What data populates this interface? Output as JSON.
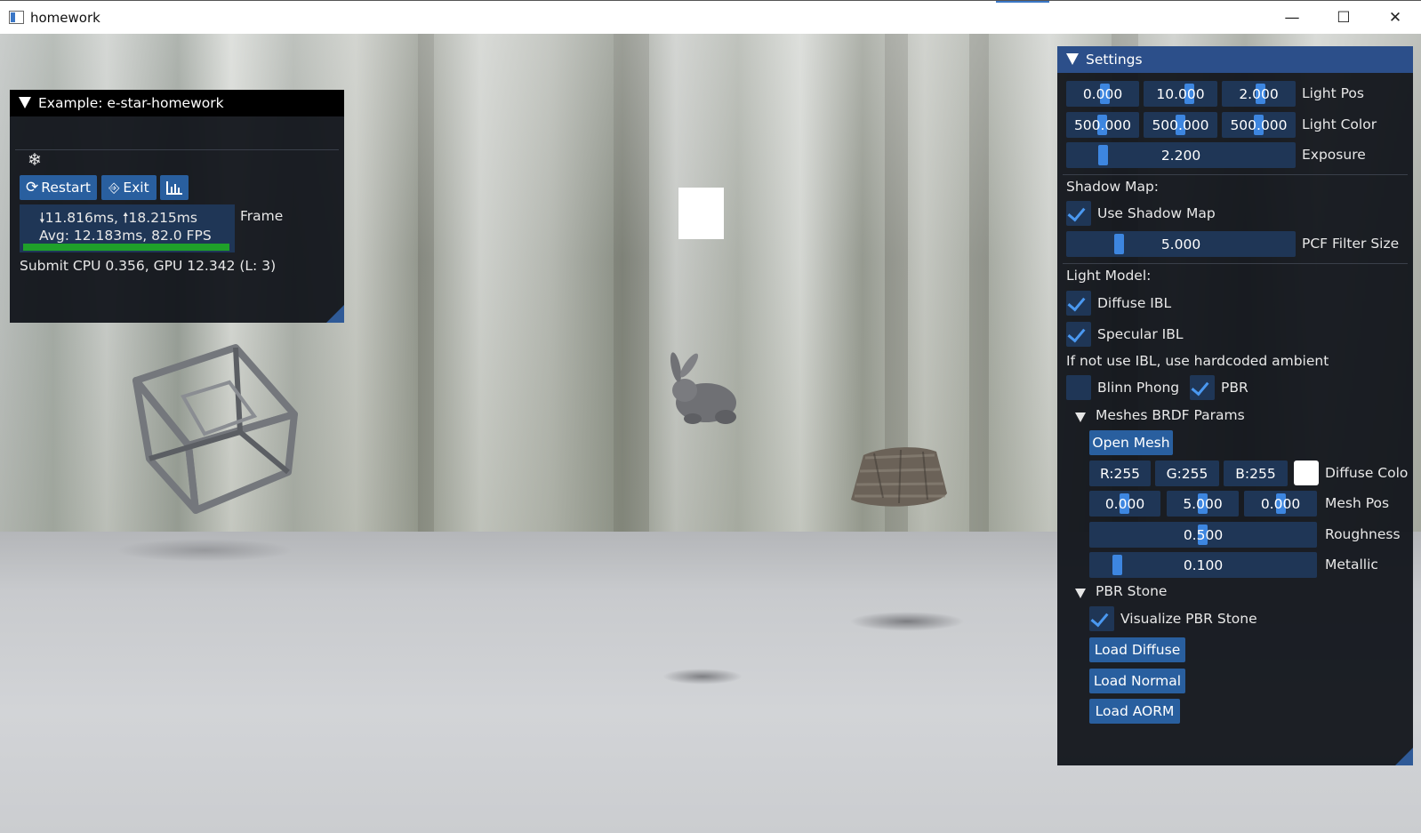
{
  "window": {
    "title": "homework",
    "controls": {
      "minimize": "—",
      "maximize": "☐",
      "close": "✕"
    }
  },
  "example_panel": {
    "title": "Example: e-star-homework",
    "icon": "snowflake-icon",
    "icon_glyph": "❄",
    "buttons": {
      "restart": {
        "icon": "refresh-icon",
        "glyph": "⟳",
        "label": "Restart"
      },
      "exit": {
        "icon": "exit-door-icon",
        "glyph": "⎆",
        "label": "Exit"
      },
      "stats": {
        "icon": "bar-chart-icon",
        "glyph": "📊"
      }
    },
    "frame": {
      "times": "🠗11.816ms, 🠕18.215ms",
      "avg": "Avg: 12.183ms, 82.0 FPS",
      "label": "Frame"
    },
    "submit": "Submit CPU 0.356, GPU 12.342 (L: 3)"
  },
  "settings": {
    "title": "Settings",
    "light_pos": {
      "values": [
        "0.000",
        "10.000",
        "2.000"
      ],
      "label": "Light Pos"
    },
    "light_color": {
      "values": [
        "500.000",
        "500.000",
        "500.000"
      ],
      "label": "Light Color"
    },
    "exposure": {
      "value": "2.200",
      "label": "Exposure"
    },
    "shadow_map_heading": "Shadow Map:",
    "use_shadow_map": {
      "label": "Use Shadow Map",
      "checked": true
    },
    "pcf": {
      "value": "5.000",
      "label": "PCF Filter Size"
    },
    "light_model_heading": "Light Model:",
    "diffuse_ibl": {
      "label": "Diffuse IBL",
      "checked": true
    },
    "specular_ibl": {
      "label": "Specular IBL",
      "checked": true
    },
    "ibl_note": "If not use IBL, use hardcoded ambient",
    "blinn_phong": {
      "label": "Blinn Phong",
      "checked": false
    },
    "pbr": {
      "label": "PBR",
      "checked": true
    },
    "meshes_brdf": {
      "title": "Meshes BRDF Params",
      "open_mesh": "Open Mesh",
      "diffuse_color": {
        "values": [
          "R:255",
          "G:255",
          "B:255"
        ],
        "label": "Diffuse Colo",
        "swatch": "#ffffff"
      },
      "mesh_pos": {
        "values": [
          "0.000",
          "5.000",
          "0.000"
        ],
        "label": "Mesh Pos"
      },
      "roughness": {
        "value": "0.500",
        "label": "Roughness"
      },
      "metallic": {
        "value": "0.100",
        "label": "Metallic"
      }
    },
    "pbr_stone": {
      "title": "PBR Stone",
      "visualize": {
        "label": "Visualize PBR Stone",
        "checked": true
      },
      "load_diffuse": "Load Diffuse",
      "load_normal": "Load Normal",
      "load_aorm": "Load AORM"
    }
  },
  "colors": {
    "header_active": "#2c4f8a",
    "button": "#295f9f",
    "frame_bg": "#1f3656",
    "slider_grab": "#3d86e0",
    "check": "#4a98f0",
    "fps_bar": "#1fa02a"
  }
}
